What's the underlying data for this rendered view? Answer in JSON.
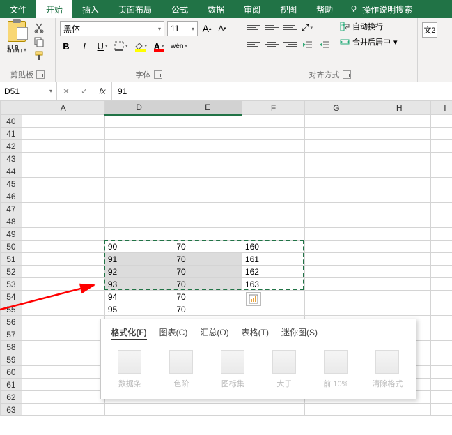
{
  "tabs": {
    "file": "文件",
    "home": "开始",
    "insert": "插入",
    "layout": "页面布局",
    "formula": "公式",
    "data": "数据",
    "review": "审阅",
    "view": "视图",
    "help": "帮助",
    "tellme": "操作说明搜索"
  },
  "ribbon": {
    "clipboard": {
      "paste": "粘贴",
      "group": "剪贴板"
    },
    "font": {
      "name": "黑体",
      "size": "11",
      "group": "字体",
      "bold": "B",
      "italic": "I",
      "underline": "U",
      "increase": "A",
      "decrease": "A",
      "phonetic": "wén"
    },
    "align": {
      "group": "对齐方式",
      "wrap": "自动换行",
      "merge": "合并后居中"
    },
    "frag": "文2"
  },
  "fbar": {
    "name": "D51",
    "value": "91"
  },
  "cols": [
    "A",
    "D",
    "E",
    "F",
    "G",
    "H",
    "I"
  ],
  "rows": [
    40,
    41,
    42,
    43,
    44,
    45,
    46,
    47,
    48,
    49,
    50,
    51,
    52,
    53,
    54,
    55,
    56,
    57,
    58,
    59,
    60,
    61,
    62,
    63
  ],
  "cells": {
    "50": {
      "D": "90",
      "E": "70",
      "F": "160"
    },
    "51": {
      "D": "91",
      "E": "70",
      "F": "161"
    },
    "52": {
      "D": "92",
      "E": "70",
      "F": "162"
    },
    "53": {
      "D": "93",
      "E": "70",
      "F": "163"
    },
    "54": {
      "D": "94",
      "E": "70",
      "F": ""
    },
    "55": {
      "D": "95",
      "E": "70",
      "F": ""
    }
  },
  "qa": {
    "tabs": {
      "format": "格式化(F)",
      "chart": "图表(C)",
      "total": "汇总(O)",
      "table": "表格(T)",
      "spark": "迷你图(S)"
    },
    "opts": {
      "databar": "数据条",
      "colorscale": "色阶",
      "iconset": "图标集",
      "greater": "大于",
      "top10": "前 10%",
      "clear": "清除格式"
    }
  },
  "chart_data": {
    "type": "table",
    "columns": [
      "D",
      "E",
      "F"
    ],
    "rows": [
      {
        "row": 50,
        "D": 90,
        "E": 70,
        "F": 160
      },
      {
        "row": 51,
        "D": 91,
        "E": 70,
        "F": 161
      },
      {
        "row": 52,
        "D": 92,
        "E": 70,
        "F": 162
      },
      {
        "row": 53,
        "D": 93,
        "E": 70,
        "F": 163
      },
      {
        "row": 54,
        "D": 94,
        "E": 70,
        "F": null
      },
      {
        "row": 55,
        "D": 95,
        "E": 70,
        "F": null
      }
    ],
    "selection": "D51:E53"
  }
}
